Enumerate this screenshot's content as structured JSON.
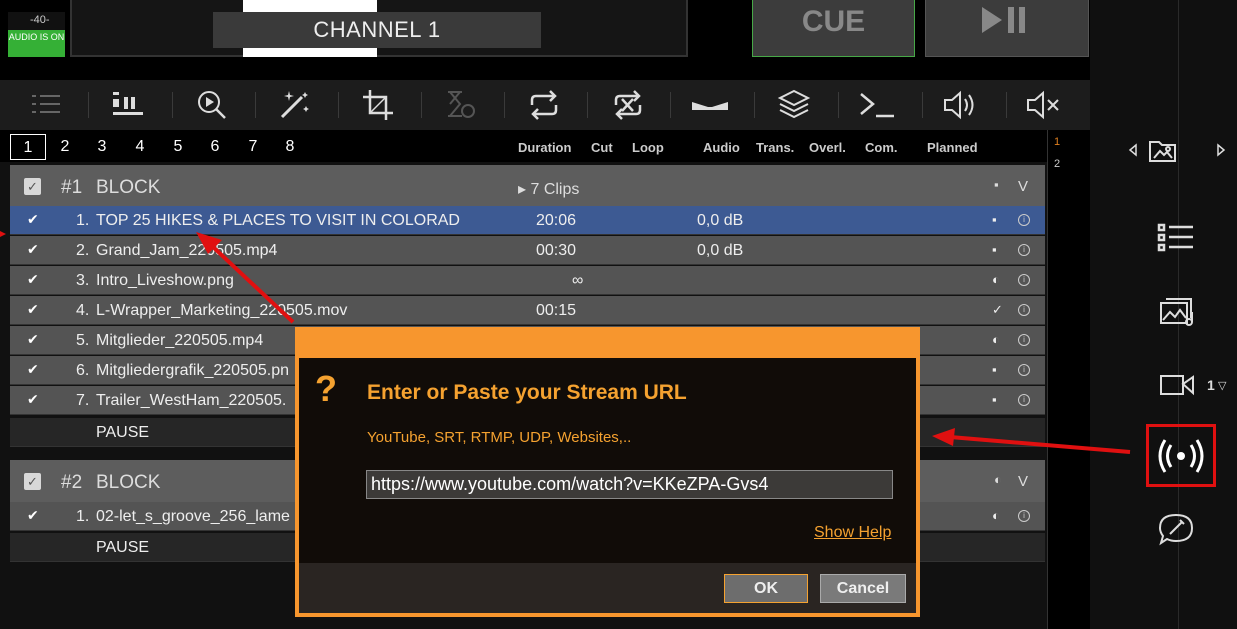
{
  "header": {
    "audio_meter_value": "-40-",
    "audio_status": "AUDIO IS ON",
    "channel_label": "CHANNEL 1",
    "cue_label": "CUE"
  },
  "toolbar": {
    "icons": [
      "list-icon",
      "pause-insert-icon",
      "preview-icon",
      "magic-wand-icon",
      "crop-icon",
      "timer-icon",
      "loop-icon",
      "shuffle-off-icon",
      "transition-icon",
      "layers-icon",
      "command-icon",
      "volume-icon",
      "mute-icon"
    ]
  },
  "tabs": [
    "1",
    "2",
    "3",
    "4",
    "5",
    "6",
    "7",
    "8"
  ],
  "columns": {
    "duration": "Duration",
    "cut": "Cut",
    "loop": "Loop",
    "audio": "Audio",
    "trans": "Trans.",
    "overl": "Overl.",
    "com": "Com.",
    "planned": "Planned"
  },
  "scroll_markers": [
    "1",
    "2"
  ],
  "blocks": [
    {
      "number": "#1",
      "name": "BLOCK",
      "clips": "▸ 7 Clips",
      "items": [
        {
          "idx": "1.",
          "title": "TOP 25 HIKES & PLACES TO VISIT IN COLORAD",
          "duration": "20:06",
          "audio": "0,0 dB",
          "status": "▪"
        },
        {
          "idx": "2.",
          "title": "Grand_Jam_220505.mp4",
          "duration": "00:30",
          "audio": "0,0 dB",
          "status": "▪"
        },
        {
          "idx": "3.",
          "title": "Intro_Liveshow.png",
          "duration": "∞",
          "audio": "",
          "status": "◐"
        },
        {
          "idx": "4.",
          "title": "L-Wrapper_Marketing_220505.mov",
          "duration": "00:15",
          "audio": "",
          "status": "✓"
        },
        {
          "idx": "5.",
          "title": "Mitglieder_220505.mp4",
          "duration": "",
          "audio": "",
          "status": "◐"
        },
        {
          "idx": "6.",
          "title": "Mitgliedergrafik_220505.pn",
          "duration": "",
          "audio": "",
          "status": "▪"
        },
        {
          "idx": "7.",
          "title": "Trailer_WestHam_220505.",
          "duration": "",
          "audio": "",
          "status": "▪"
        }
      ],
      "pause": "PAUSE"
    },
    {
      "number": "#2",
      "name": "BLOCK",
      "items": [
        {
          "idx": "1.",
          "title": "02-let_s_groove_256_lame",
          "duration": "",
          "audio": "",
          "status": "◐"
        }
      ],
      "pause": "PAUSE"
    }
  ],
  "sidebar": {
    "camera_number": "1"
  },
  "dialog": {
    "title": "Enter or Paste your Stream URL",
    "subtitle": "YouTube, SRT, RTMP, UDP, Websites,..",
    "url_value": "https://www.youtube.com/watch?v=KKeZPA-Gvs4",
    "help_link": "Show Help",
    "ok_label": "OK",
    "cancel_label": "Cancel"
  },
  "colors": {
    "accent_orange": "#f7962e",
    "selected_row": "#3d5a93",
    "audio_on_green": "#35b036",
    "annotation_red": "#e01010"
  }
}
